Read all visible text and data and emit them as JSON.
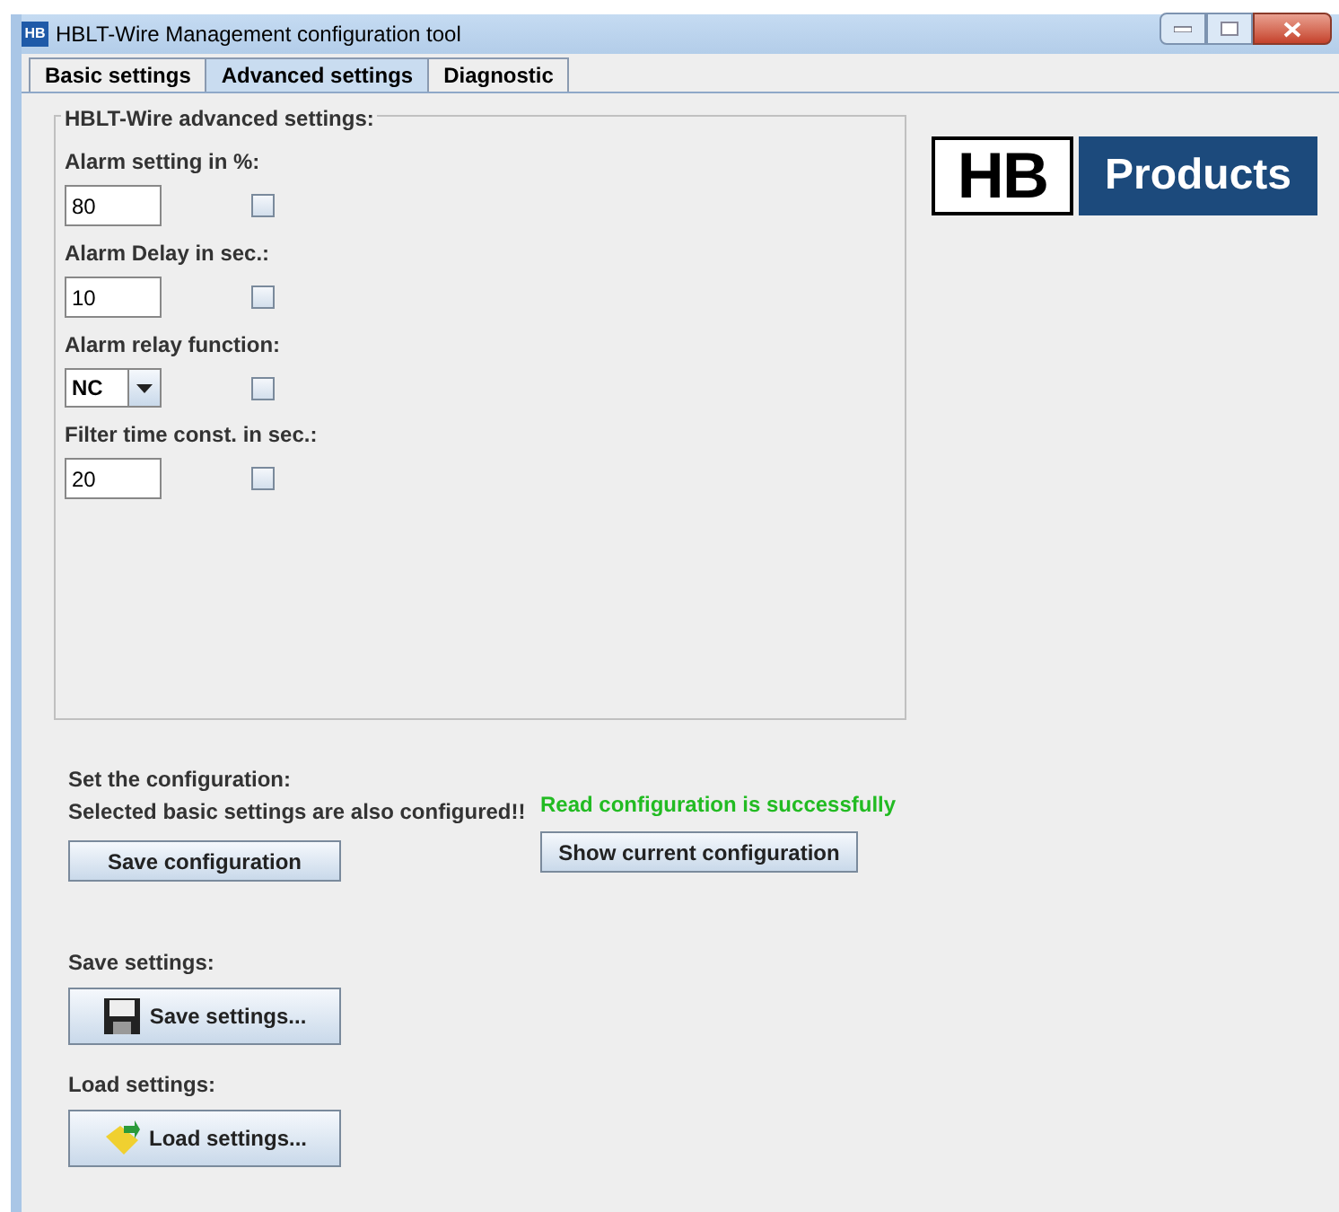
{
  "window": {
    "title": "HBLT-Wire Management configuration tool",
    "app_icon": "HB"
  },
  "tabs": [
    {
      "label": "Basic settings",
      "selected": false
    },
    {
      "label": "Advanced settings",
      "selected": true
    },
    {
      "label": "Diagnostic",
      "selected": false
    }
  ],
  "group": {
    "title": "HBLT-Wire advanced settings:",
    "fields": [
      {
        "label": "Alarm setting in %:",
        "kind": "text",
        "value": "80",
        "checked": false
      },
      {
        "label": "Alarm Delay in sec.:",
        "kind": "text",
        "value": "10",
        "checked": false
      },
      {
        "label": "Alarm relay function:",
        "kind": "combo",
        "value": "NC",
        "checked": false
      },
      {
        "label": "Filter time const. in sec.:",
        "kind": "text",
        "value": "20",
        "checked": false
      }
    ]
  },
  "logo": {
    "left": "HB",
    "right": "Products"
  },
  "configuration": {
    "label": "Set the configuration:",
    "note": "Selected basic settings are also configured!!",
    "button": "Save configuration",
    "status": "Read configuration is successfully",
    "show_button": "Show current configuration"
  },
  "save_settings": {
    "label": "Save settings:",
    "button": "Save settings..."
  },
  "load_settings": {
    "label": "Load settings:",
    "button": "Load settings..."
  }
}
